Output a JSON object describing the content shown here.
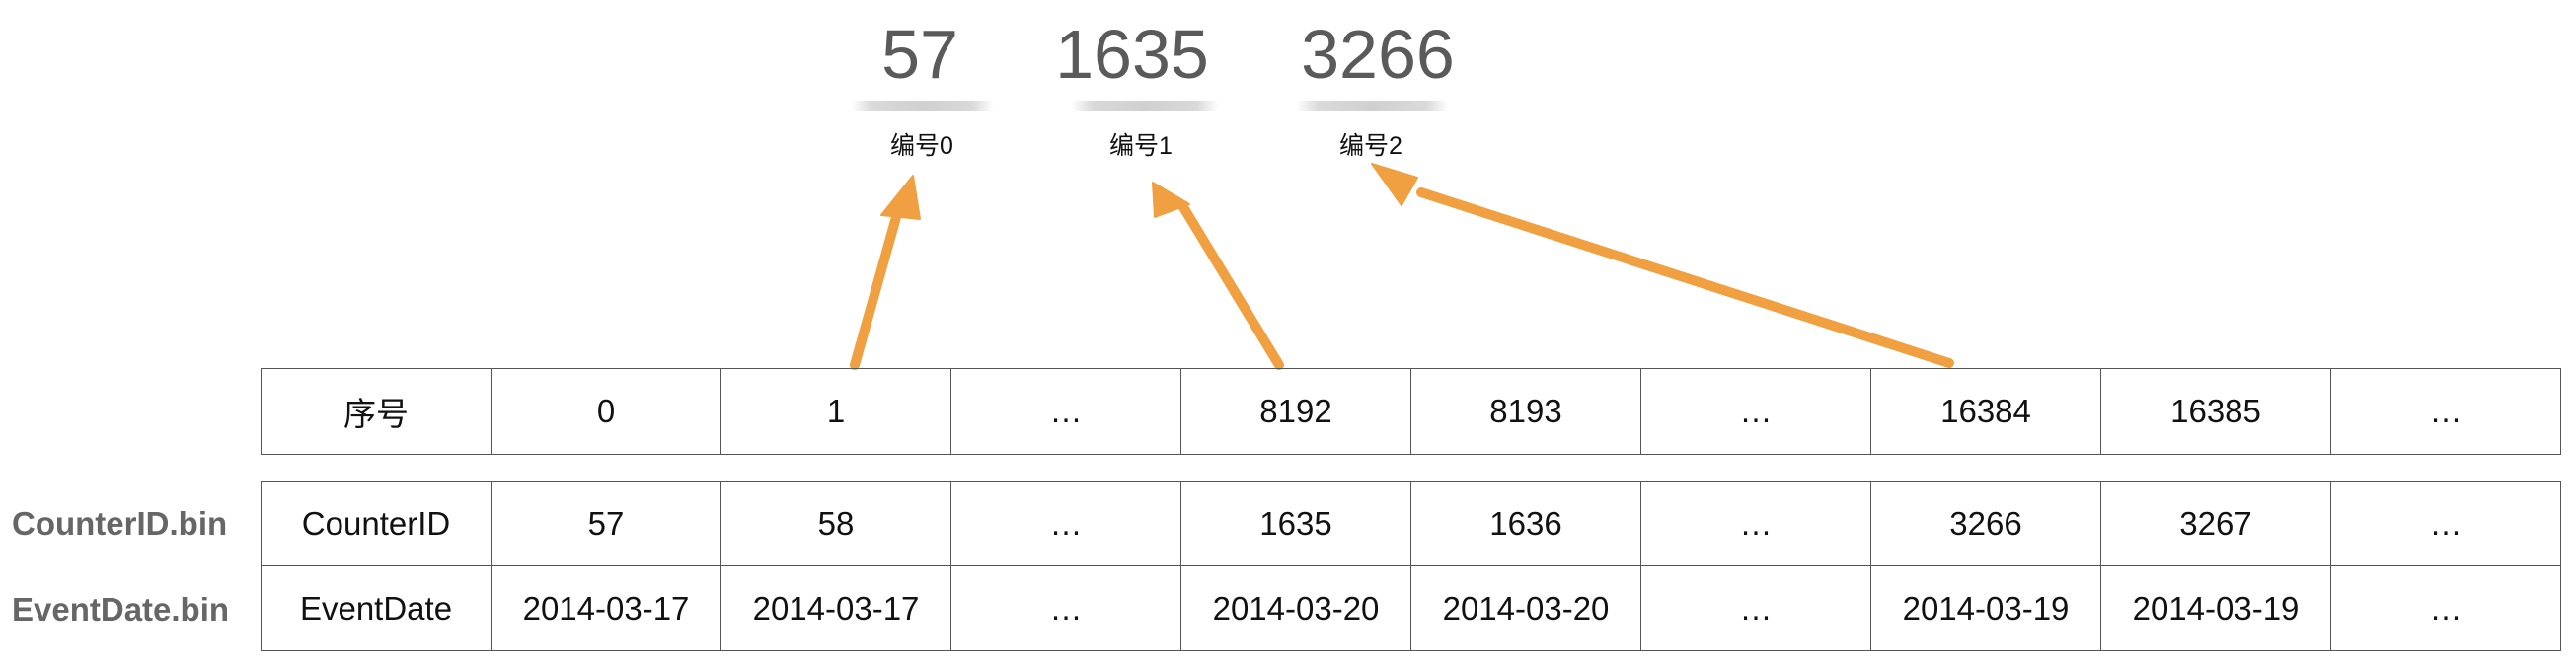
{
  "marks": [
    {
      "value": "57",
      "label": "编号0"
    },
    {
      "value": "1635",
      "label": "编号1"
    },
    {
      "value": "3266",
      "label": "编号2"
    }
  ],
  "index_row": [
    "序号",
    "0",
    "1",
    "…",
    "8192",
    "8193",
    "…",
    "16384",
    "16385",
    "…"
  ],
  "files": [
    {
      "file": "CounterID.bin",
      "cells": [
        "CounterID",
        "57",
        "58",
        "…",
        "1635",
        "1636",
        "…",
        "3266",
        "3267",
        "…"
      ]
    },
    {
      "file": "EventDate.bin",
      "cells": [
        "EventDate",
        "2014-03-17",
        "2014-03-17",
        "…",
        "2014-03-20",
        "2014-03-20",
        "…",
        "2014-03-19",
        "2014-03-19",
        "…"
      ]
    }
  ],
  "colors": {
    "arrow": "#f0a040",
    "mark_text": "#5a5a5a",
    "file_label": "#666666"
  }
}
